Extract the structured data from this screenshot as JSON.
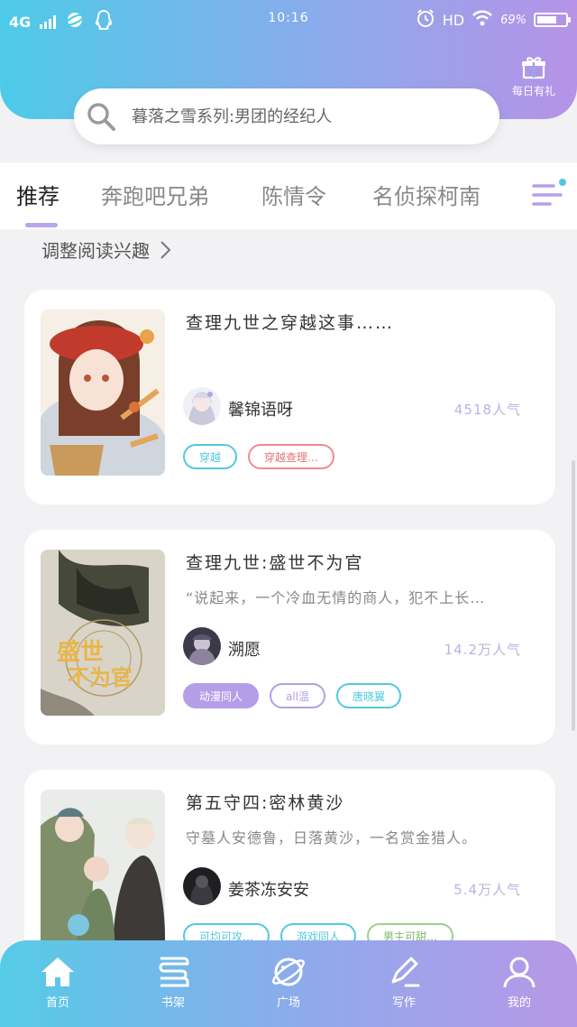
{
  "status_bar": {
    "network": "4G",
    "time": "10:16",
    "hd": "HD",
    "battery": "69%",
    "battery_level": 0.69
  },
  "header": {
    "daily_gift_label": "每日有礼"
  },
  "search": {
    "placeholder": "暮落之雪系列:男团的经纪人"
  },
  "tabs": [
    {
      "label": "推荐"
    },
    {
      "label": "奔跑吧兄弟"
    },
    {
      "label": "陈情令"
    },
    {
      "label": "名侦探柯南"
    }
  ],
  "interest_link": {
    "label": "调整阅读兴趣"
  },
  "cards": [
    {
      "title": "查理九世之穿越这事……",
      "summary": "",
      "author": "馨锦语呀",
      "popularity": "4518人气",
      "tags": [
        "穿越",
        "穿越查理…"
      ]
    },
    {
      "title": "查理九世:盛世不为官",
      "summary": "“说起来，一个冷血无情的商人，犯不上长…",
      "author": "溯愿",
      "popularity": "14.2万人气",
      "tags": [
        "动漫同人",
        "all温",
        "唐晓翼"
      ]
    },
    {
      "title": "第五守四:密林黄沙",
      "summary": "守墓人安德鲁，日落黄沙，一名赏金猎人。",
      "author": "姜茶冻安安",
      "popularity": "5.4万人气",
      "tags": [
        "可均可攻…",
        "游戏同人",
        "男主可甜…"
      ]
    }
  ],
  "bottom_nav": [
    {
      "label": "首页",
      "icon": "home-icon"
    },
    {
      "label": "书架",
      "icon": "bookshelf-icon"
    },
    {
      "label": "广场",
      "icon": "planet-icon"
    },
    {
      "label": "写作",
      "icon": "pen-icon"
    },
    {
      "label": "我的",
      "icon": "user-icon"
    }
  ]
}
